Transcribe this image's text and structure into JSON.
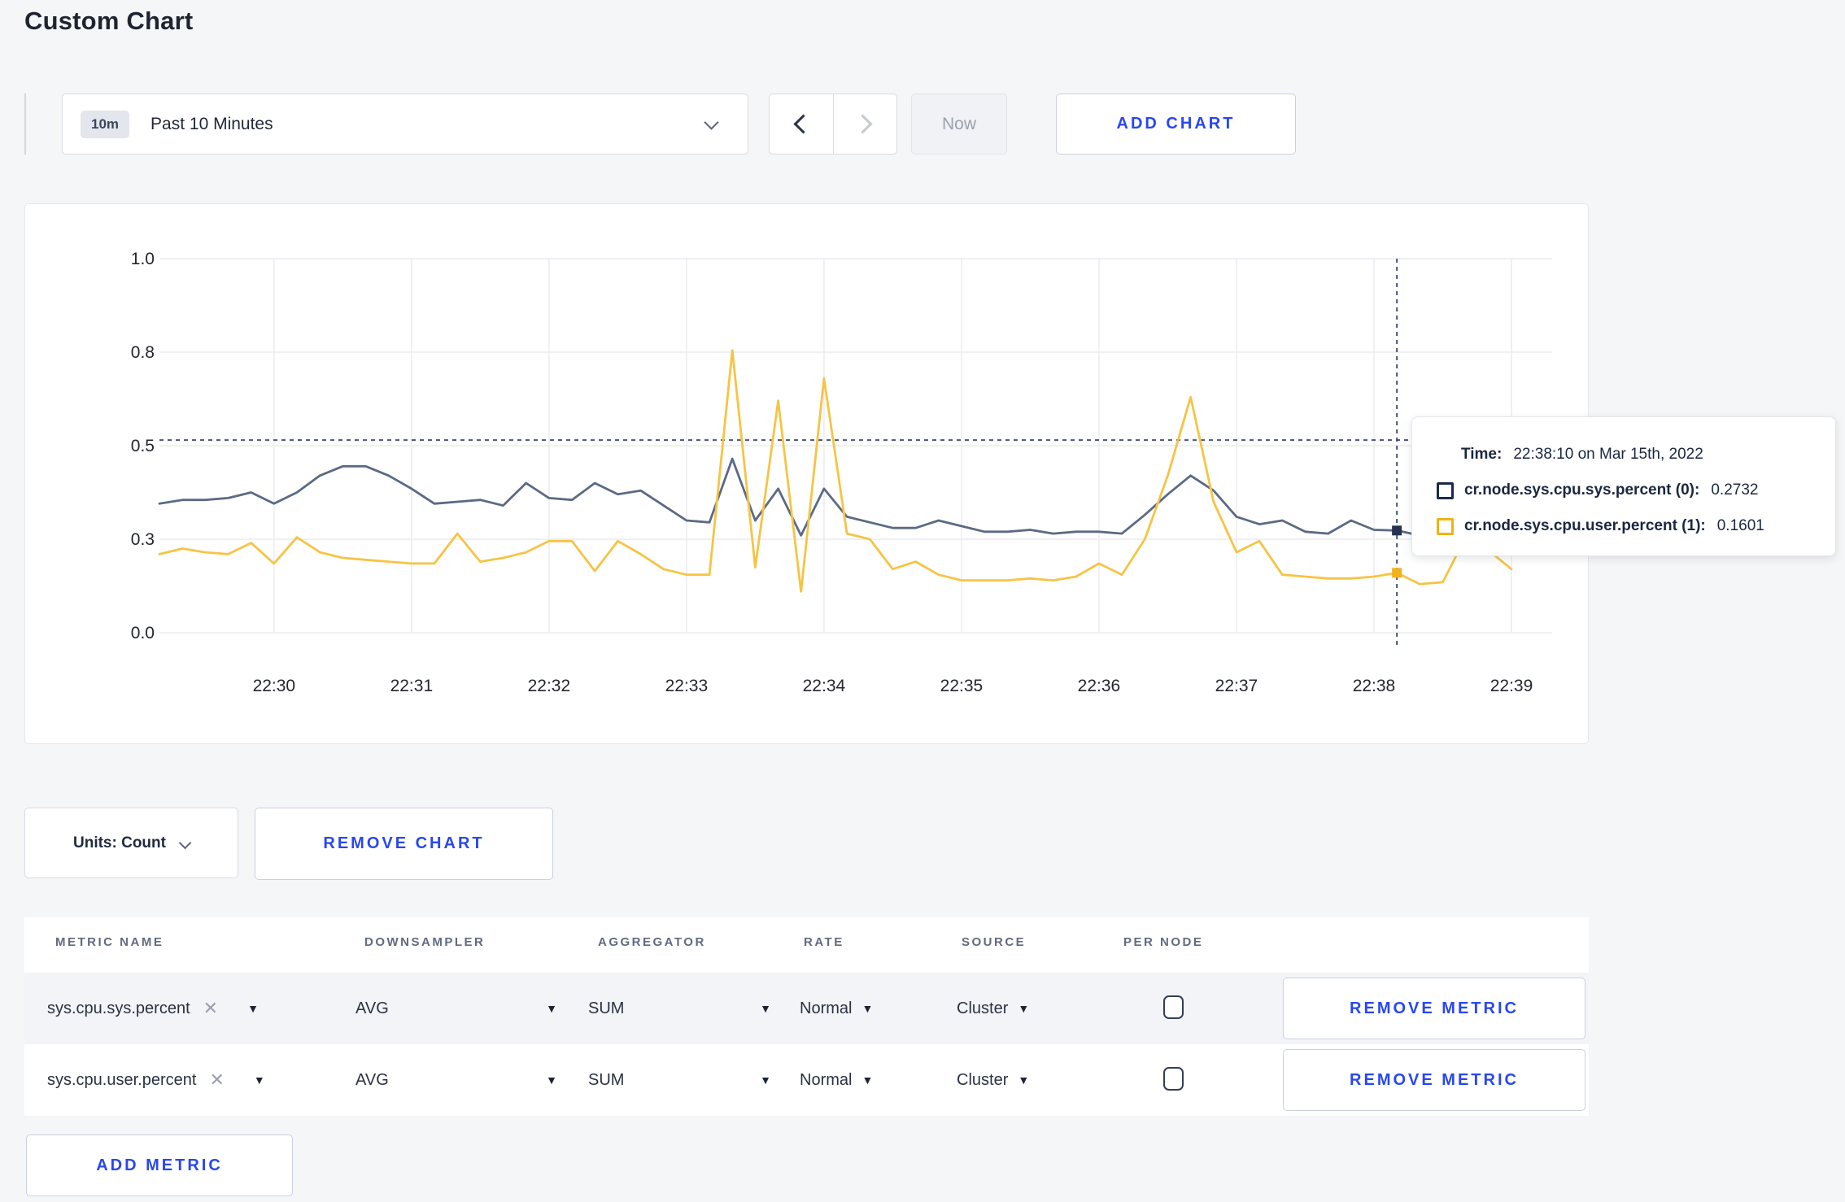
{
  "page": {
    "title": "Custom Chart"
  },
  "toolbar": {
    "range_badge": "10m",
    "range_label": "Past 10 Minutes",
    "now_label": "Now",
    "add_chart_label": "ADD CHART"
  },
  "chart_data": {
    "type": "line",
    "x_start": "22:29:10",
    "x_step_seconds": 10,
    "x_ticks": [
      "22:30",
      "22:31",
      "22:32",
      "22:33",
      "22:34",
      "22:35",
      "22:36",
      "22:37",
      "22:38",
      "22:39"
    ],
    "y_ticks": {
      "values": [
        0,
        0.25,
        0.5,
        0.75,
        1.0
      ],
      "labels": [
        "0.0",
        "0.3",
        "0.5",
        "0.8",
        "1.0"
      ]
    },
    "ylim": [
      0,
      1
    ],
    "grid": true,
    "guide_line_y": 0.515,
    "crosshair_time": "22:38:10",
    "series": [
      {
        "name": "cr.node.sys.cpu.sys.percent (0)",
        "color": "#5b6a85",
        "marker_color": "#26324f",
        "values": [
          0.345,
          0.355,
          0.355,
          0.36,
          0.375,
          0.345,
          0.375,
          0.42,
          0.445,
          0.445,
          0.42,
          0.385,
          0.345,
          0.35,
          0.355,
          0.34,
          0.4,
          0.36,
          0.355,
          0.4,
          0.37,
          0.38,
          0.34,
          0.3,
          0.295,
          0.465,
          0.3,
          0.385,
          0.26,
          0.385,
          0.31,
          0.295,
          0.28,
          0.28,
          0.3,
          0.285,
          0.27,
          0.27,
          0.275,
          0.265,
          0.27,
          0.27,
          0.265,
          0.315,
          0.37,
          0.42,
          0.38,
          0.31,
          0.29,
          0.3,
          0.27,
          0.265,
          0.3,
          0.275,
          0.2732,
          0.26,
          0.26,
          0.27,
          0.265,
          0.27
        ]
      },
      {
        "name": "cr.node.sys.cpu.user.percent (1)",
        "color": "#f6c445",
        "marker_color": "#f2b21c",
        "values": [
          0.21,
          0.225,
          0.215,
          0.21,
          0.24,
          0.185,
          0.255,
          0.215,
          0.2,
          0.195,
          0.19,
          0.185,
          0.185,
          0.265,
          0.19,
          0.2,
          0.215,
          0.245,
          0.245,
          0.165,
          0.245,
          0.21,
          0.17,
          0.155,
          0.155,
          0.755,
          0.175,
          0.62,
          0.11,
          0.68,
          0.265,
          0.25,
          0.17,
          0.19,
          0.155,
          0.14,
          0.14,
          0.14,
          0.145,
          0.14,
          0.15,
          0.185,
          0.155,
          0.25,
          0.42,
          0.63,
          0.35,
          0.215,
          0.245,
          0.155,
          0.15,
          0.145,
          0.145,
          0.15,
          0.1601,
          0.13,
          0.135,
          0.255,
          0.22,
          0.17
        ]
      }
    ]
  },
  "tooltip": {
    "time_label": "Time:",
    "time_value": "22:38:10 on Mar 15th, 2022",
    "rows": [
      {
        "label": "cr.node.sys.cpu.sys.percent (0):",
        "value": "0.2732",
        "color": "#1b2a4a"
      },
      {
        "label": "cr.node.sys.cpu.user.percent (1):",
        "value": "0.1601",
        "color": "#efb312"
      }
    ]
  },
  "chart_controls": {
    "units_label": "Units: Count",
    "remove_chart_label": "REMOVE CHART"
  },
  "metrics_table": {
    "headers": [
      "METRIC NAME",
      "DOWNSAMPLER",
      "AGGREGATOR",
      "RATE",
      "SOURCE",
      "PER NODE"
    ],
    "clear_icon": "✕",
    "dropdown_icon": "▼",
    "rows": [
      {
        "metric": "sys.cpu.sys.percent",
        "downsampler": "AVG",
        "aggregator": "SUM",
        "rate": "Normal",
        "source": "Cluster",
        "per_node_checked": false,
        "remove_label": "REMOVE METRIC"
      },
      {
        "metric": "sys.cpu.user.percent",
        "downsampler": "AVG",
        "aggregator": "SUM",
        "rate": "Normal",
        "source": "Cluster",
        "per_node_checked": false,
        "remove_label": "REMOVE METRIC"
      }
    ],
    "add_metric_label": "ADD METRIC"
  }
}
